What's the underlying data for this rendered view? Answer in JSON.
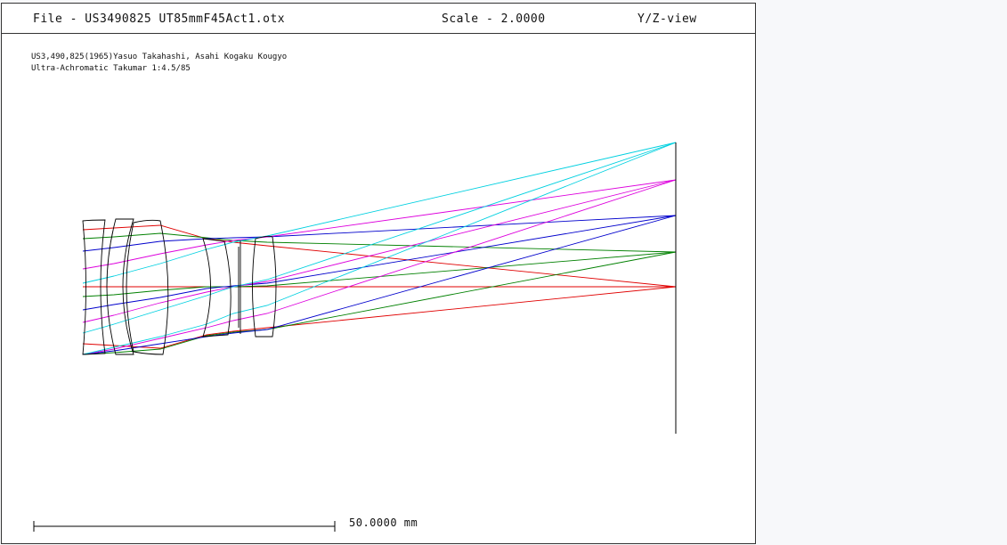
{
  "header": {
    "file": "File - US3490825 UT85mmF45Act1.otx",
    "scale": "Scale - 2.0000",
    "view": "Y/Z-view"
  },
  "notes": [
    "US3,490,825(1965)Yasuo Takahashi, Asahi Kogaku Kougyo",
    "Ultra-Achromatic Takumar 1:4.5/85"
  ],
  "scale_bar": {
    "label": "50.0000 mm"
  },
  "colors": {
    "red": "#e00000",
    "green": "#008000",
    "blue": "#0000cc",
    "magenta": "#dd00dd",
    "cyan": "#00d0e0",
    "lens": "#000000"
  }
}
